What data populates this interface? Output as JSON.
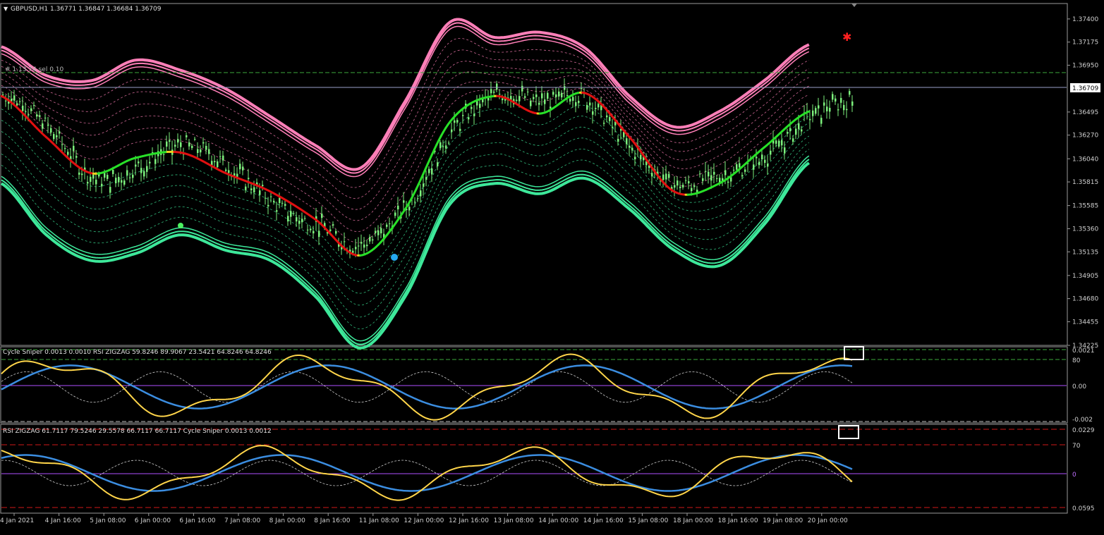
{
  "window": {
    "symbol_header": "GBPUSD,H1  1.36771 1.36847 1.36684 1.36709",
    "overlay_note": "#  1.13  74  sel 0.10"
  },
  "price_panel": {
    "current_price_label": "1.36709",
    "y_ticks": [
      "1.37400",
      "1.37175",
      "1.36950",
      "1.36709",
      "1.36495",
      "1.36270",
      "1.36040",
      "1.35815",
      "1.35585",
      "1.35360",
      "1.35135",
      "1.34905",
      "1.34680",
      "1.34455",
      "1.34225"
    ]
  },
  "oscillator_1": {
    "title": "Cycle Sniper 0.0013 0.0010  RSI ZIGZAG 59.8246 89.9067 23.5421 64.8246 64.8246",
    "y_ticks": [
      "0.0021",
      "80",
      "0.00",
      "-0.002"
    ]
  },
  "oscillator_2": {
    "title": "RSI ZIGZAG 61.7117 79.5246 29.5578 66.7117 66.7117  Cycle Sniper 0.0013 0.0012",
    "y_ticks": [
      "0.0229",
      "70",
      "0",
      "0.0595"
    ]
  },
  "x_axis": {
    "labels": [
      "4 Jan 2021",
      "4 Jan 16:00",
      "5 Jan 08:00",
      "6 Jan 00:00",
      "6 Jan 16:00",
      "7 Jan 08:00",
      "8 Jan 00:00",
      "8 Jan 16:00",
      "11 Jan 08:00",
      "12 Jan 00:00",
      "12 Jan 16:00",
      "13 Jan 08:00",
      "14 Jan 00:00",
      "14 Jan 16:00",
      "15 Jan 08:00",
      "18 Jan 00:00",
      "18 Jan 16:00",
      "19 Jan 08:00",
      "20 Jan 00:00"
    ]
  },
  "colors": {
    "bull_line": "#28e028",
    "bear_line": "#e01010",
    "flat_line": "#f0d020",
    "upper_band": "#ff7fb8",
    "lower_band": "#3de89a",
    "candles": "#7cf07c",
    "osc_yellow": "#ffd54a",
    "osc_blue": "#3b8de0",
    "dashed_green": "#3ca83c",
    "dashed_red": "#d01818"
  },
  "chart_data": {
    "type": "line",
    "title": "GBPUSD,H1",
    "x": [
      "4 Jan 2021",
      "4 Jan 16:00",
      "5 Jan 08:00",
      "6 Jan 00:00",
      "6 Jan 16:00",
      "7 Jan 08:00",
      "8 Jan 00:00",
      "8 Jan 16:00",
      "11 Jan 08:00",
      "12 Jan 00:00",
      "12 Jan 16:00",
      "13 Jan 08:00",
      "14 Jan 00:00",
      "14 Jan 16:00",
      "15 Jan 08:00",
      "18 Jan 00:00",
      "18 Jan 16:00",
      "19 Jan 08:00",
      "20 Jan 00:00"
    ],
    "ylim": [
      1.34225,
      1.3755
    ],
    "series": [
      {
        "values": [
          1.3665,
          1.3625,
          1.359,
          1.3605,
          1.361,
          1.359,
          1.3572,
          1.3545,
          1.351,
          1.3555,
          1.364,
          1.3665,
          1.3648,
          1.3668,
          1.3625,
          1.3572,
          1.358,
          1.3615,
          1.365
        ]
      },
      {
        "values": [
          1.3713,
          1.3685,
          1.368,
          1.37,
          1.369,
          1.3672,
          1.3645,
          1.3617,
          1.3595,
          1.366,
          1.3737,
          1.3722,
          1.3727,
          1.3712,
          1.3665,
          1.3635,
          1.365,
          1.368,
          1.3715
        ]
      },
      {
        "values": [
          1.358,
          1.353,
          1.3505,
          1.3512,
          1.353,
          1.3515,
          1.3505,
          1.347,
          1.342,
          1.347,
          1.356,
          1.358,
          1.357,
          1.3585,
          1.3555,
          1.3515,
          1.35,
          1.354,
          1.36
        ]
      }
    ]
  }
}
